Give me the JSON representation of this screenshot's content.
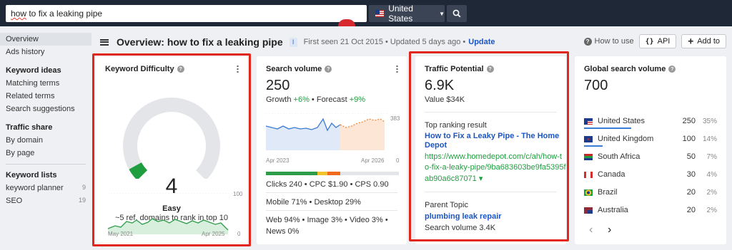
{
  "topbar": {
    "search_value": "fix a leaking pipe",
    "search_prefix": "how",
    "search_to": " to ",
    "country_label": "United States",
    "search_icon": "search-icon"
  },
  "sidebar": {
    "overview": "Overview",
    "ads_history": "Ads history",
    "keyword_ideas_head": "Keyword ideas",
    "matching_terms": "Matching terms",
    "related_terms": "Related terms",
    "search_suggestions": "Search suggestions",
    "traffic_share_head": "Traffic share",
    "by_domain": "By domain",
    "by_page": "By page",
    "keyword_lists_head": "Keyword lists",
    "lists": [
      {
        "label": "keyword planner",
        "count": "9"
      },
      {
        "label": "SEO",
        "count": "19"
      }
    ]
  },
  "header": {
    "title": "Overview: how to fix a leaking pipe",
    "badge": "I",
    "meta": "First seen 21 Oct 2015 • Updated 5 days ago •",
    "update": "Update",
    "how_to_use": "How to use",
    "api": "API",
    "add_to": "Add to"
  },
  "kd": {
    "title": "Keyword Difficulty",
    "value": "4",
    "level": "Easy",
    "sub": "~5 ref. domains to rank in top 10",
    "axis_max": "100",
    "axis_min": "0",
    "start": "May 2021",
    "end": "Apr 2025",
    "gauge_fraction": 0.04
  },
  "sv": {
    "title": "Search volume",
    "value": "250",
    "growth_label": "Growth",
    "growth_value": "+6%",
    "forecast_label": "Forecast",
    "forecast_value": "+9%",
    "axis_max": "383",
    "axis_min": "0",
    "start": "Apr 2023",
    "end": "Apr 2026",
    "clicks": "Clicks 240 • CPC $1.90 • CPS 0.90",
    "devices": "Mobile 71% • Desktop 29%",
    "serp": "Web 94% • Image 3% • Video 3% •",
    "news": "News 0%"
  },
  "tp": {
    "title": "Traffic Potential",
    "value": "6.9K",
    "value_label": "Value $34K",
    "top_result_label": "Top ranking result",
    "top_result_title_1": "How to Fix a Leaky Pipe - The Home",
    "top_result_title_2": "Depot",
    "url_1": "https://www.homedepot.com/c/ah/how-t",
    "url_2": "o-fix-a-leaky-pipe/9ba683603be9fa5395f",
    "url_3": "ab90a6c87071 ▾",
    "parent_topic_label": "Parent Topic",
    "parent_topic": "plumbing leak repair",
    "parent_volume": "Search volume 3.4K"
  },
  "gv": {
    "title": "Global search volume",
    "value": "700",
    "countries": [
      {
        "name": "United States",
        "volume": "250",
        "pct": "35%",
        "flag": "us"
      },
      {
        "name": "United Kingdom",
        "volume": "100",
        "pct": "14%",
        "flag": "uk"
      },
      {
        "name": "South Africa",
        "volume": "50",
        "pct": "7%",
        "flag": "za"
      },
      {
        "name": "Canada",
        "volume": "30",
        "pct": "4%",
        "flag": "ca"
      },
      {
        "name": "Brazil",
        "volume": "20",
        "pct": "2%",
        "flag": "br"
      },
      {
        "name": "Australia",
        "volume": "20",
        "pct": "2%",
        "flag": "au"
      }
    ],
    "prev": "‹",
    "next": "›"
  },
  "colors": {
    "accent_red": "#e2261c",
    "link_blue": "#1a56c4",
    "green": "#1e9e3e",
    "topbar": "#1f2836"
  }
}
